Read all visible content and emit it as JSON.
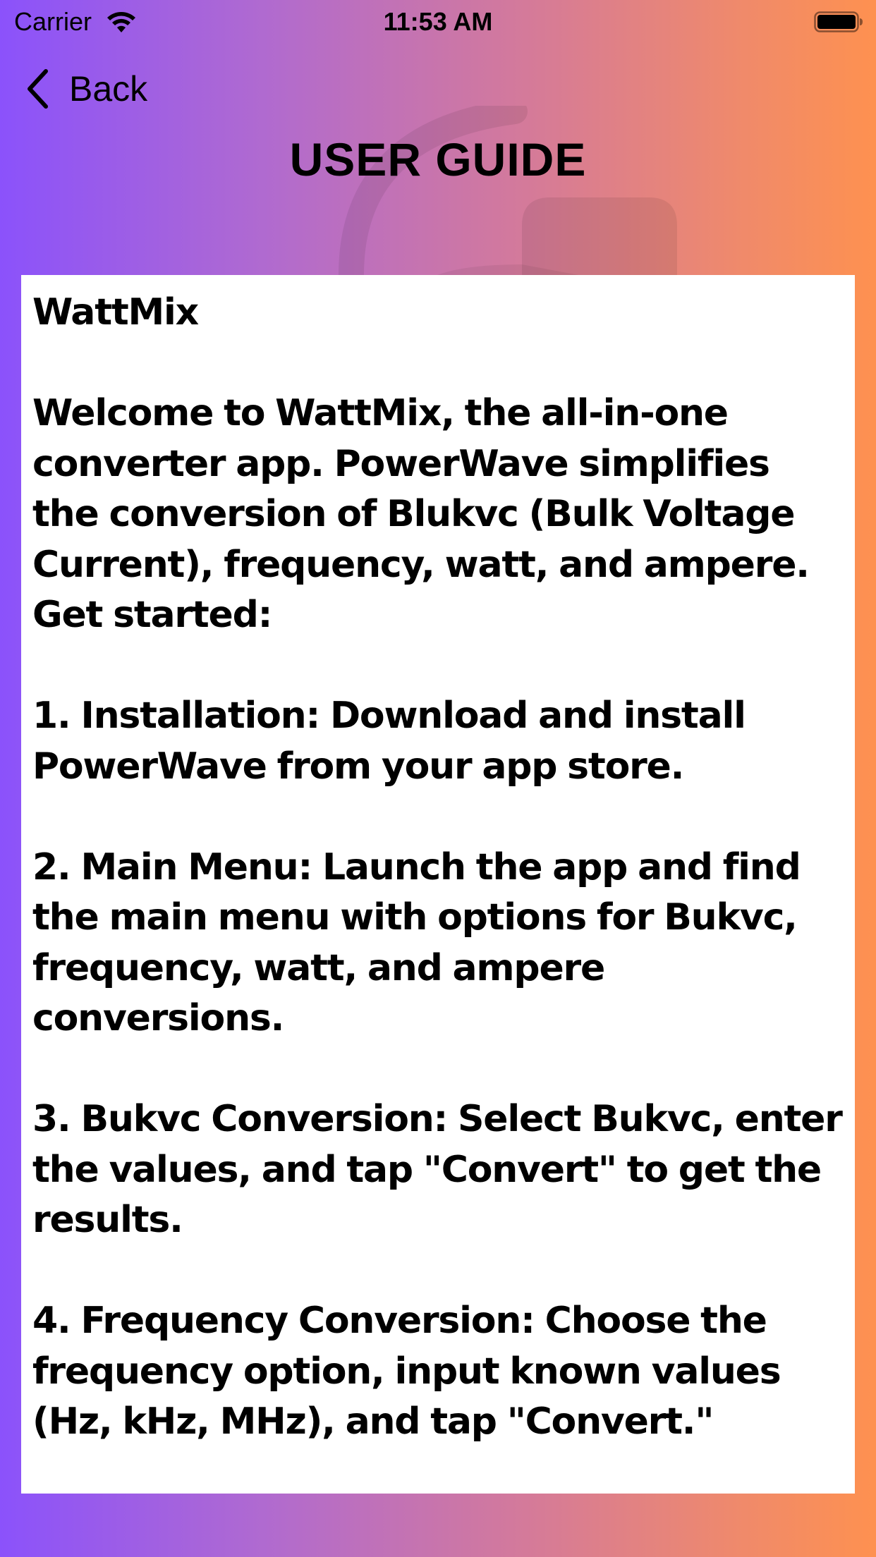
{
  "status_bar": {
    "carrier": "Carrier",
    "time": "11:53 AM",
    "icons": [
      "wifi-icon",
      "battery-icon"
    ]
  },
  "nav": {
    "back_label": "Back",
    "back_icon": "chevron-left-icon"
  },
  "page": {
    "title": "USER GUIDE"
  },
  "guide": {
    "text": "WattMix\n\nWelcome to WattMix, the all-in-one converter app. PowerWave simplifies the conversion of Blukvc (Bulk Voltage Current), frequency, watt, and ampere. Get started:\n\n1. Installation: Download and install PowerWave from your app store.\n\n2. Main Menu: Launch the app and find the main menu with options for Bukvc, frequency, watt, and ampere conversions.\n\n3. Bukvc Conversion: Select Bukvc, enter the values, and tap \"Convert\" to get the results.\n\n4. Frequency Conversion: Choose the frequency option, input known values (Hz, kHz, MHz), and tap \"Convert.\""
  },
  "colors": {
    "gradient_left": "#8b52fb",
    "gradient_right": "#fe9150",
    "card_background": "#ffffff",
    "text": "#000000"
  }
}
